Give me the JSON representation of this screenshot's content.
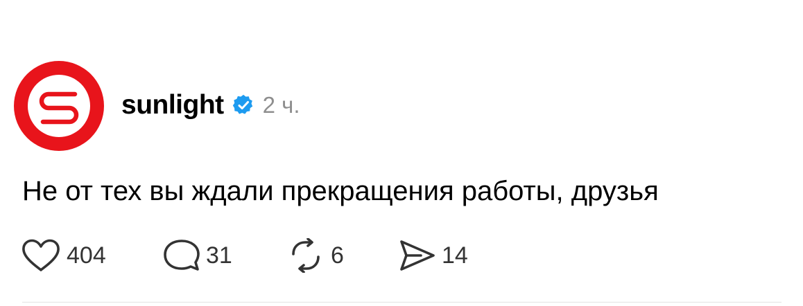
{
  "post": {
    "author": {
      "username": "sunlight",
      "verified": true,
      "avatar_icon": "sunlight-logo-icon",
      "brand_color": "#e8141b"
    },
    "timestamp": "2 ч.",
    "text": "Не от тех вы ждали прекращения работы, друзья",
    "actions": {
      "likes": {
        "icon": "heart-icon",
        "count": "404"
      },
      "comments": {
        "icon": "comment-icon",
        "count": "31"
      },
      "reposts": {
        "icon": "repost-icon",
        "count": "6"
      },
      "shares": {
        "icon": "send-icon",
        "count": "14"
      }
    },
    "colors": {
      "verified_badge": "#1d9bf0",
      "muted_text": "#8e8e8e"
    }
  }
}
